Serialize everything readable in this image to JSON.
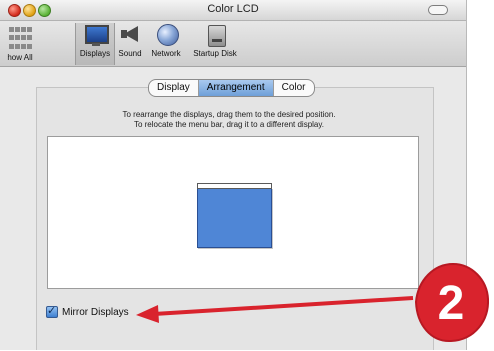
{
  "window": {
    "title": "Color LCD",
    "traffic_lights": [
      "close",
      "minimize",
      "zoom"
    ]
  },
  "toolbar": {
    "items": [
      {
        "label": "how All",
        "icon": "grid-icon"
      },
      {
        "label": "Displays",
        "icon": "display-icon",
        "selected": true
      },
      {
        "label": "Sound",
        "icon": "speaker-icon"
      },
      {
        "label": "Network",
        "icon": "globe-icon"
      },
      {
        "label": "Startup Disk",
        "icon": "disk-icon"
      }
    ]
  },
  "tabs": {
    "items": [
      {
        "label": "Display"
      },
      {
        "label": "Arrangement",
        "active": true
      },
      {
        "label": "Color"
      }
    ]
  },
  "instructions": {
    "line1": "To rearrange the displays, drag them to the desired position.",
    "line2": "To relocate the menu bar, drag it to a different display."
  },
  "mirror": {
    "label": "Mirror Displays",
    "checked": true
  },
  "callout": {
    "number": "2",
    "color": "#d9232d",
    "arrow_color": "#d9232d"
  }
}
